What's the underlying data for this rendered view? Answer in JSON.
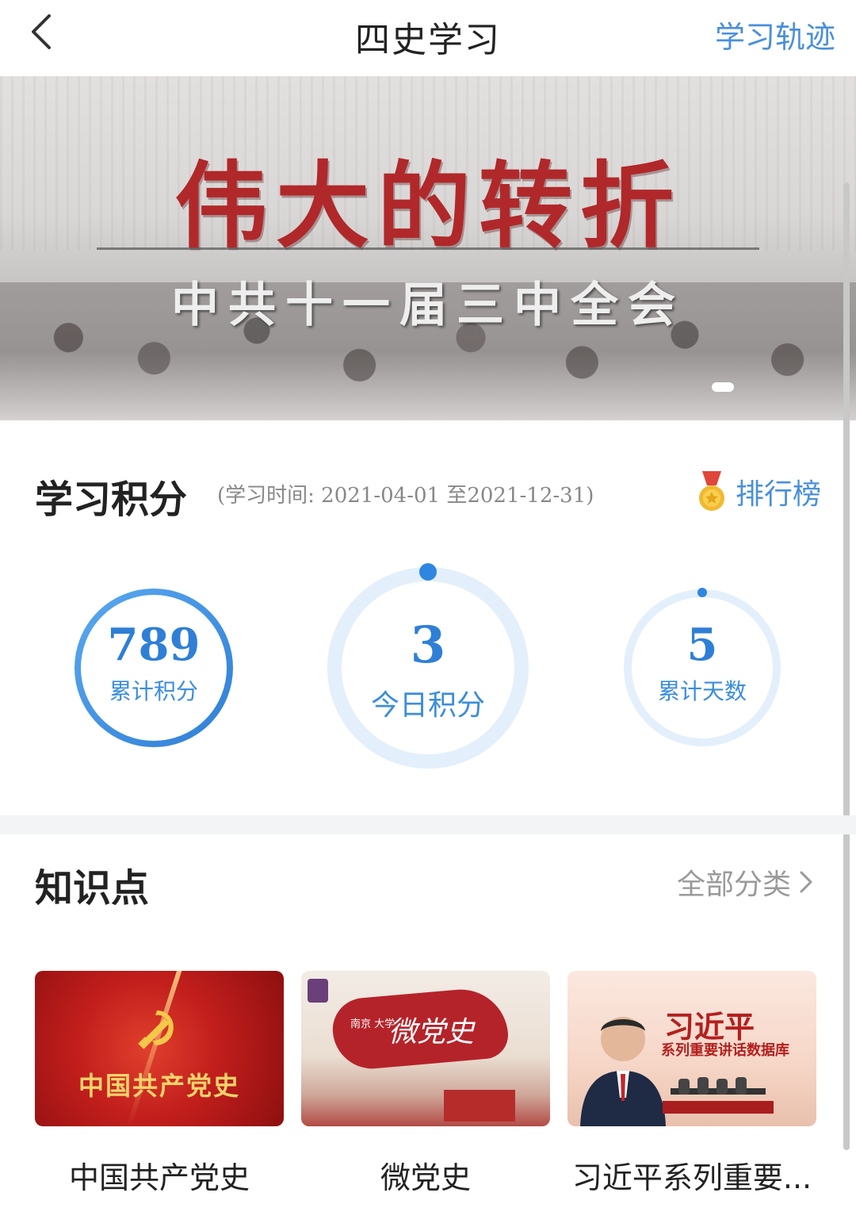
{
  "header": {
    "title": "四史学习",
    "right_link": "学习轨迹"
  },
  "banner": {
    "title": "伟大的转折",
    "subtitle": "中共十一届三中全会"
  },
  "points": {
    "title": "学习积分",
    "period": "(学习时间: 2021-04-01 至2021-12-31)",
    "ranking_label": "排行榜",
    "stats": [
      {
        "value": "789",
        "label": "累计积分"
      },
      {
        "value": "3",
        "label": "今日积分"
      },
      {
        "value": "5",
        "label": "累计天数"
      }
    ]
  },
  "knowledge": {
    "title": "知识点",
    "all_categories": "全部分类",
    "cards": [
      {
        "title": "中国共产党史",
        "image_text": "中国共产党史"
      },
      {
        "title": "微党史",
        "image_text": "微党史",
        "image_small_text": "南京 大学"
      },
      {
        "title": "习近平系列重要...",
        "image_text": "习近平",
        "image_subtext": "系列重要讲话数据库"
      }
    ]
  },
  "colors": {
    "accent": "#4a90d9",
    "banner_title": "#b0282a",
    "card1_bg": "#c11e1c"
  },
  "icons": [
    "back-icon",
    "medal-icon",
    "chevron-right-icon"
  ]
}
